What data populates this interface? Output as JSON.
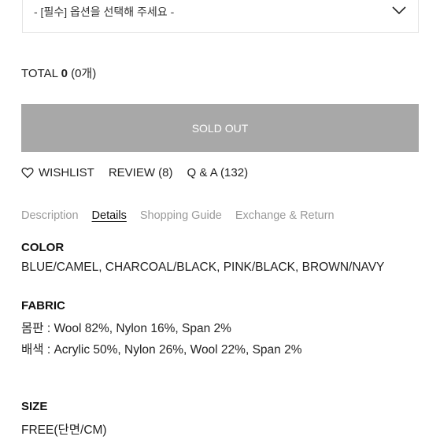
{
  "option_select": {
    "placeholder": "- [필수] 옵션을 선택해 주세요 -"
  },
  "total": {
    "label": "TOTAL",
    "amount": "0",
    "count": "(0개)"
  },
  "buy_button": {
    "label": "SOLD OUT"
  },
  "links": {
    "wishlist": "WISHLIST",
    "review": "REVIEW (8)",
    "qa": "Q & A (132)"
  },
  "tabs": [
    {
      "label": "Description",
      "active": false
    },
    {
      "label": "Details",
      "active": true
    },
    {
      "label": "Shopping Guide",
      "active": false
    },
    {
      "label": "Exchange & Return",
      "active": false
    }
  ],
  "details": {
    "color": {
      "title": "COLOR",
      "value": "BLUE/CAMEL, CHARCOAL/BLACK, PINK/BLACK, BROWN/NAVY"
    },
    "fabric": {
      "title": "FABRIC",
      "lines": [
        "몸판 : Wool 82%, Nylon 16%, Span 2%",
        "배색 : Acrylic 50%, Nylon 26%, Wool 22%, Span 2%"
      ]
    },
    "size": {
      "title": "SIZE",
      "value": "FREE(단면/CM)"
    }
  },
  "colors": {
    "soldout_bg": "#a8a8a8",
    "tab_inactive": "#9a9a9a"
  }
}
